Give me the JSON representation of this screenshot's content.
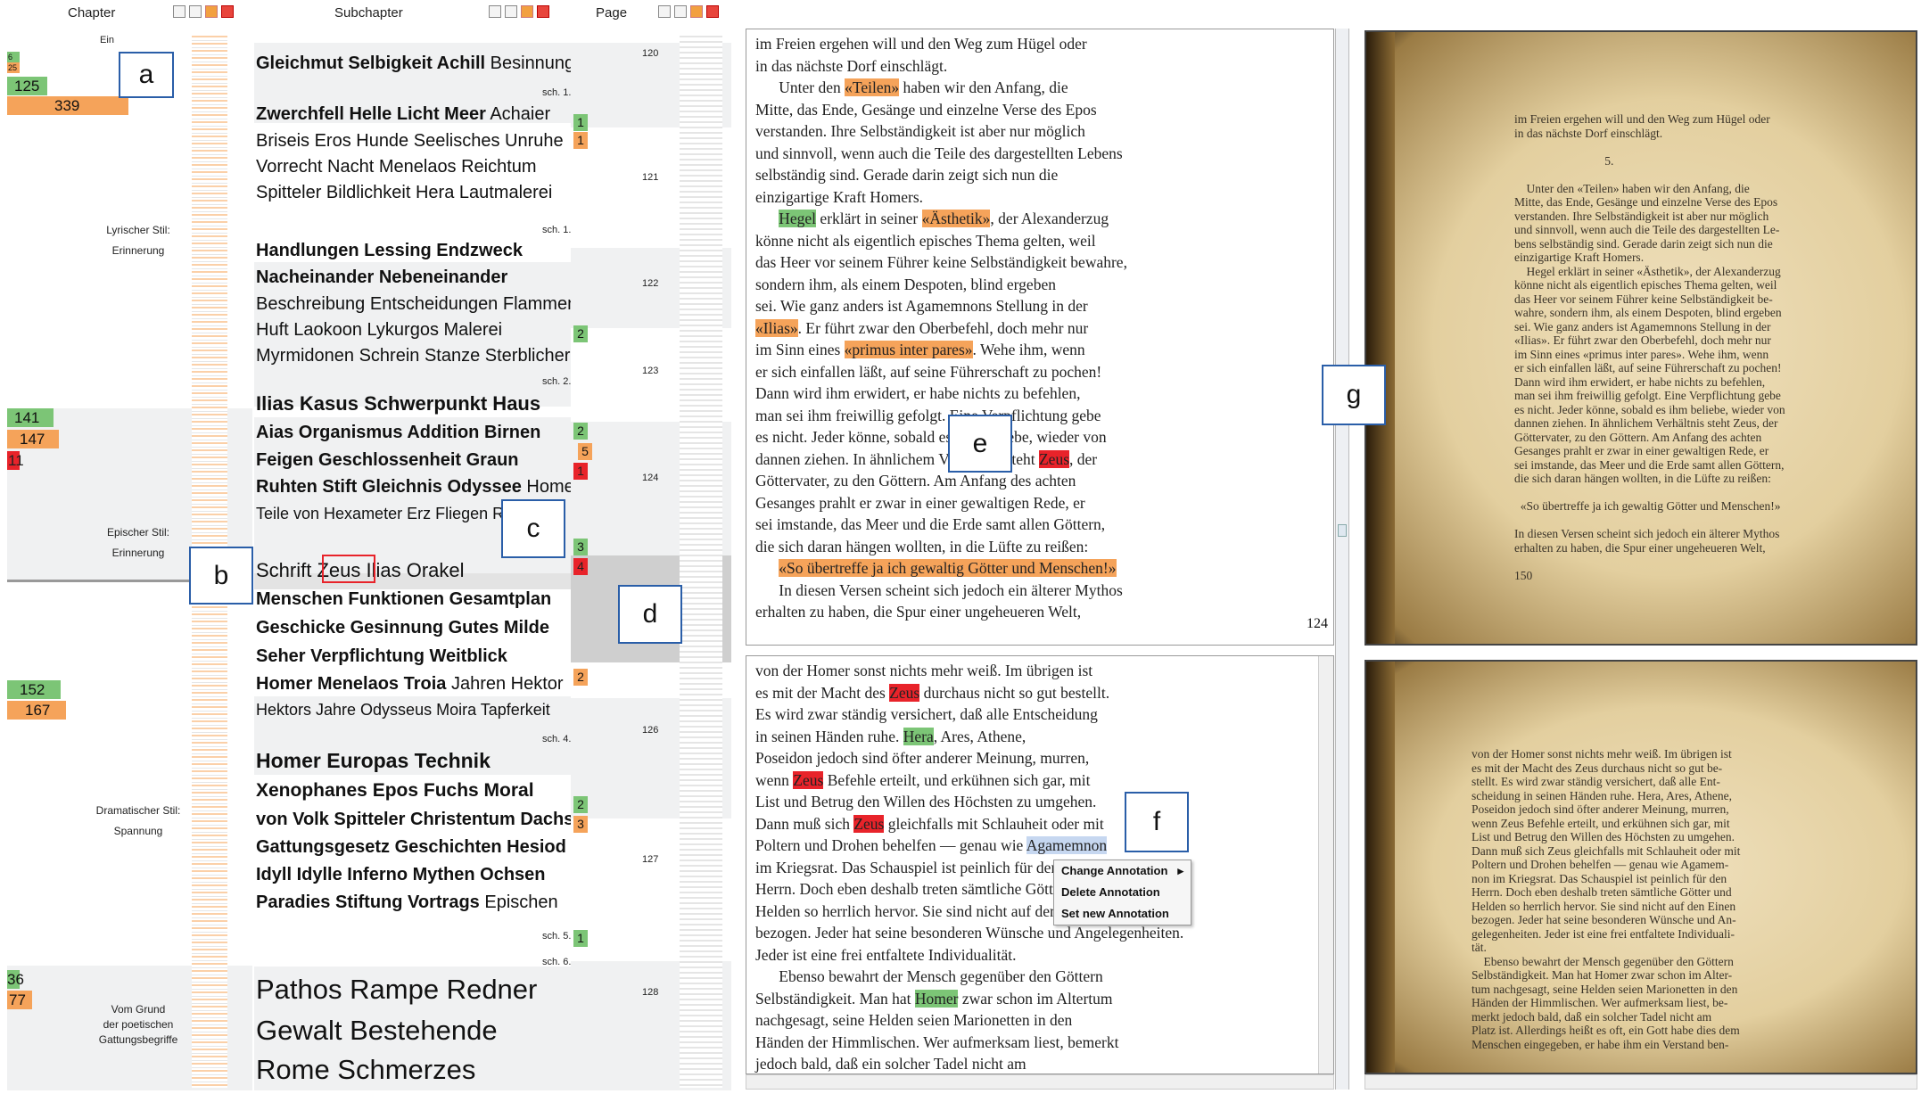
{
  "headers": {
    "chapter": "Chapter",
    "subchapter": "Subchapter",
    "page": "Page"
  },
  "callouts": {
    "a": "a",
    "b": "b",
    "c": "c",
    "d": "d",
    "e": "e",
    "f": "f",
    "g": "g"
  },
  "chapter_labels": [
    "Ein",
    "Lyrischer Stil:",
    "Erinnerung",
    "Epischer Stil:",
    "Erinnerung",
    "Dramatischer Stil:",
    "Spannung",
    "Vom Grund",
    "der poetischen",
    "Gattungsbegriffe"
  ],
  "chapter_counts": {
    "c0a": "6",
    "c0b": "25",
    "c1": "125",
    "c2": "339",
    "c3": "141",
    "c4": "147",
    "c5": "11",
    "c6": "152",
    "c7": "167",
    "c8": "36",
    "c9": "77"
  },
  "keywords": [
    {
      "bold": "Gleichmut Selbigkeit Achill",
      "normal": "Besinnung"
    },
    {
      "bold": "Zwerchfell Helle Licht Meer",
      "normal": "Achaier"
    },
    {
      "bold": "",
      "normal": "Briseis Eros Hunde Seelisches Unruhe"
    },
    {
      "bold": "",
      "normal": "Vorrecht Nacht Menelaos Reichtum"
    },
    {
      "bold": "",
      "normal": "Spitteler Bildlichkeit Hera Lautmalerei"
    },
    {
      "bold": "Handlungen Lessing Endzweck",
      "normal": ""
    },
    {
      "bold": "Nacheinander Nebeneinander",
      "normal": ""
    },
    {
      "bold": "",
      "normal": "Beschreibung Entscheidungen Flammen"
    },
    {
      "bold": "",
      "normal": "Huft Laokoon Lykurgos Malerei"
    },
    {
      "bold": "",
      "normal": "Myrmidonen Schrein Stanze Sterblicher"
    },
    {
      "bold": "Ilias Kasus Schwerpunkt Haus",
      "normal": ""
    },
    {
      "bold": "Aias Organismus Addition Birnen",
      "normal": ""
    },
    {
      "bold": "Feigen Geschlossenheit Graun",
      "normal": ""
    },
    {
      "bold": "Ruhten Stift Gleichnis Odyssee",
      "normal": "Homer"
    },
    {
      "bold": "",
      "normal": "Teile von Hexameter Erz Fliegen R"
    },
    {
      "bold": "",
      "normal": "Schrift Zeus Ilias Orakel"
    },
    {
      "bold": "Menschen Funktionen Gesamtplan",
      "normal": ""
    },
    {
      "bold": "Geschicke Gesinnung Gutes Milde",
      "normal": ""
    },
    {
      "bold": "Seher Verpflichtung Weitblick",
      "normal": ""
    },
    {
      "bold": "Homer Menelaos Troia",
      "normal": "Jahren Hektor"
    },
    {
      "bold": "",
      "normal": "Hektors Jahre Odysseus Moira Tapferkeit"
    },
    {
      "bold": "Homer Europas Technik",
      "normal": ""
    },
    {
      "bold": "Xenophanes Epos Fuchs Moral",
      "normal": ""
    },
    {
      "bold": "von Volk Spitteler Christentum Dachs",
      "normal": ""
    },
    {
      "bold": "Gattungsgesetz Geschichten Hesiod",
      "normal": ""
    },
    {
      "bold": "Idyll Idylle Inferno Mythen Ochsen",
      "normal": ""
    },
    {
      "bold": "Paradies Stiftung Vortrags",
      "normal": "Epischen"
    },
    {
      "bold": "Pathos",
      "normal": "Rampe Redner"
    },
    {
      "bold": "",
      "normal": "Gewalt Bestehende"
    },
    {
      "bold": "",
      "normal": "Rome Schmerzes"
    }
  ],
  "sch_labels": [
    "sch. 1.",
    "sch. 1.",
    "sch. 2.",
    "sch. 4.",
    "sch. 5.",
    "sch. 6."
  ],
  "mini_counts": [
    "1",
    "1",
    "2",
    "2",
    "5",
    "1",
    "3",
    "4",
    "2",
    "2",
    "3",
    "1"
  ],
  "pages": [
    "120",
    "121",
    "122",
    "123",
    "124",
    "126",
    "127",
    "128"
  ],
  "text_top": [
    [
      "im Freien ergehen will und den Weg zum Hügel oder",
      ""
    ],
    [
      "in das nächste Dorf einschlägt.",
      ""
    ],
    [
      "      Unter den ",
      "",
      "«Teilen»",
      "ho",
      " haben wir den Anfang, die",
      ""
    ],
    [
      "Mitte, das Ende, Gesänge und einzelne Verse des Epos",
      ""
    ],
    [
      "verstanden. Ihre Selbständigkeit ist aber nur möglich",
      ""
    ],
    [
      "und sinnvoll, wenn auch die Teile des dargestellten Lebens",
      ""
    ],
    [
      "selbständig sind. Gerade darin zeigt sich nun die",
      ""
    ],
    [
      "einzigartige Kraft Homers.",
      ""
    ],
    [
      "      ",
      "",
      "Hegel",
      "hg",
      " erklärt in seiner ",
      "",
      "«Ästhetik»",
      "ho",
      ", der Alexanderzug",
      ""
    ],
    [
      "könne nicht als eigentlich episches Thema gelten, weil",
      ""
    ],
    [
      "das Heer vor seinem Führer keine Selbständigkeit bewahre,",
      ""
    ],
    [
      "sondern ihm, als einem Despoten, blind ergeben",
      ""
    ],
    [
      "sei. Wie ganz anders ist Agamemnons Stellung in der",
      ""
    ],
    [
      "",
      "",
      "«Ilias»",
      "ho",
      ". Er führt zwar den Oberbefehl, doch mehr nur",
      ""
    ],
    [
      "im Sinn eines ",
      "",
      "«primus inter pares»",
      "ho",
      ". Wehe ihm, wenn",
      ""
    ],
    [
      "er sich einfallen läßt, auf seine Führerschaft zu pochen!",
      ""
    ],
    [
      "Dann wird ihm erwidert, er habe nichts zu befehlen,",
      ""
    ],
    [
      "man sei ihm freiwillig gefolgt. Eine Verpflichtung gebe",
      ""
    ],
    [
      "es nicht. Jeder könne, sobald es ihm beliebe, wieder von",
      ""
    ],
    [
      "dannen ziehen. In ähnlichem Verhältnis steht ",
      "",
      "Zeus",
      "hr",
      ", der",
      ""
    ],
    [
      "Göttervater, zu den Göttern. Am Anfang des achten",
      ""
    ],
    [
      "Gesanges prahlt er zwar in einer gewaltigen Rede, er",
      ""
    ],
    [
      "sei imstande, das Meer und die Erde samt allen Göttern,",
      ""
    ],
    [
      "die sich daran hängen wollten, in die Lüfte zu reißen:",
      ""
    ],
    [
      "      ",
      "",
      "«So übertreffe ja ich gewaltig Götter und Menschen!»",
      "ho"
    ],
    [
      "      In diesen Versen scheint sich jedoch ein älterer Mythos",
      ""
    ],
    [
      "erhalten zu haben, die Spur einer ungeheueren Welt,",
      ""
    ]
  ],
  "page_footer": "124",
  "text_bottom": [
    [
      "von der Homer sonst nichts mehr weiß. Im übrigen ist",
      ""
    ],
    [
      "es mit der Macht des ",
      "",
      "Zeus",
      "hr",
      " durchaus nicht so gut bestellt.",
      ""
    ],
    [
      "Es wird zwar ständig versichert, daß alle Entscheidung",
      ""
    ],
    [
      "in seinen Händen ruhe. ",
      "",
      "Hera",
      "hg",
      ", Ares, Athene,",
      ""
    ],
    [
      "Poseidon jedoch sind öfter anderer Meinung, murren,",
      ""
    ],
    [
      "wenn ",
      "",
      "Zeus",
      "hr",
      " Befehle erteilt, und erkühnen sich gar, mit",
      ""
    ],
    [
      "List und Betrug den Willen des Höchsten zu umgehen.",
      ""
    ],
    [
      "Dann muß sich ",
      "",
      "Zeus",
      "hr",
      " gleichfalls mit Schlauheit oder mit",
      ""
    ],
    [
      "Poltern und Drohen behelfen — genau wie ",
      "",
      "Agamemnon",
      "hb"
    ],
    [
      "im Kriegsrat. Das Schauspiel ist peinlich für den",
      ""
    ],
    [
      "Herrn. Doch eben deshalb treten sämtliche Götter",
      ""
    ],
    [
      "Helden so herrlich hervor. Sie sind nicht auf den E",
      ""
    ],
    [
      "bezogen. Jeder hat seine besonderen Wünsche und Angelegenheiten.",
      ""
    ],
    [
      "Jeder ist eine frei entfaltete Individualität.",
      ""
    ],
    [
      "      Ebenso bewahrt der Mensch gegenüber den Göttern",
      ""
    ],
    [
      "Selbständigkeit. Man hat ",
      "",
      "Homer",
      "hg",
      " zwar schon im Altertum",
      ""
    ],
    [
      "nachgesagt, seine Helden seien Marionetten in den",
      ""
    ],
    [
      "Händen der Himmlischen. Wer aufmerksam liest, bemerkt",
      ""
    ],
    [
      "jedoch bald, daß ein solcher Tadel nicht am",
      ""
    ]
  ],
  "context_menu": [
    "Change Annotation",
    "Delete Annotation",
    "Set new Annotation"
  ],
  "book_top": "im Freien ergehen will und den Weg zum Hügel oder\nin das nächste Dorf einschlägt.\n\n                              5.\n\n    Unter den «Teilen» haben wir den Anfang, die\nMitte, das Ende, Gesänge und einzelne Verse des Epos\nverstanden. Ihre Selbständigkeit ist aber nur möglich\nund sinnvoll, wenn auch die Teile des dargestellten Le-\nbens selbständig sind. Gerade darin zeigt sich nun die\neinzigartige Kraft Homers.\n    Hegel erklärt in seiner «Ästhetik», der Alexanderzug\nkönne nicht als eigentlich episches Thema gelten, weil\ndas Heer vor seinem Führer keine Selbständigkeit be-\nwahre, sondern ihm, als einem Despoten, blind ergeben\nsei. Wie ganz anders ist Agamemnons Stellung in der\n«Ilias». Er führt zwar den Oberbefehl, doch mehr nur\nim Sinn eines «primus inter pares». Wehe ihm, wenn\ner sich einfallen läßt, auf seine Führerschaft zu pochen!\nDann wird ihm erwidert, er habe nichts zu befehlen,\nman sei ihm freiwillig gefolgt. Eine Verpflichtung gebe\nes nicht. Jeder könne, sobald es ihm beliebe, wieder von\ndannen ziehen. In ähnlichem Verhältnis steht Zeus, der\nGöttervater, zu den Göttern. Am Anfang des achten\nGesanges prahlt er zwar in einer gewaltigen Rede, er\nsei imstande, das Meer und die Erde samt allen Göttern,\ndie sich daran hängen wollten, in die Lüfte zu reißen:\n\n  «So übertreffe ja ich gewaltig Götter und Menschen!»\n\nIn diesen Versen scheint sich jedoch ein älterer Mythos\nerhalten zu haben, die Spur einer ungeheueren Welt,\n\n150",
  "book_bottom": "von der Homer sonst nichts mehr weiß. Im übrigen ist\nes mit der Macht des Zeus durchaus nicht so gut be-\nstellt. Es wird zwar ständig versichert, daß alle Ent-\nscheidung in seinen Händen ruhe. Hera, Ares, Athene,\nPoseidon jedoch sind öfter anderer Meinung, murren,\nwenn Zeus Befehle erteilt, und erkühnen sich gar, mit\nList und Betrug den Willen des Höchsten zu umgehen.\nDann muß sich Zeus gleichfalls mit Schlauheit oder mit\nPoltern und Drohen behelfen — genau wie Agamem-\nnon im Kriegsrat. Das Schauspiel ist peinlich für den\nHerrn. Doch eben deshalb treten sämtliche Götter und\nHelden so herrlich hervor. Sie sind nicht auf den Einen\nbezogen. Jeder hat seine besonderen Wünsche und An-\ngelegenheiten. Jeder ist eine frei entfaltete Individuali-\ntät.\n    Ebenso bewahrt der Mensch gegenüber den Göttern\nSelbständigkeit. Man hat Homer zwar schon im Alter-\ntum nachgesagt, seine Helden seien Marionetten in den\nHänden der Himmlischen. Wer aufmerksam liest, be-\nmerkt jedoch bald, daß ein solcher Tadel nicht am\nPlatz ist. Allerdings heißt es oft, ein Gott habe dies dem\nMenschen eingegeben, er habe ihm ein Verstand ben-",
  "colors": {
    "green": "#7cc576",
    "orange": "#f5a35a",
    "red": "#e8232a",
    "callout_border": "#2a5ea8"
  }
}
